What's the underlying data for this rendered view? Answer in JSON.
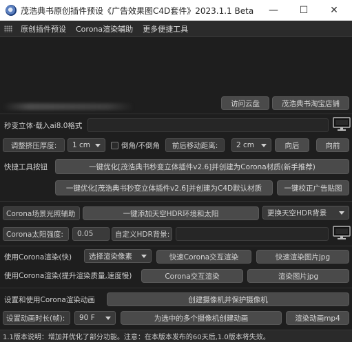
{
  "window": {
    "title": "茂浩典书原创插件预设《广告效果图C4D套件》2023.1.1 Beta",
    "minimize": "—",
    "maximize": "☐",
    "close": "✕"
  },
  "menu": [
    "原创插件预设",
    "Corona渲染辅助",
    "更多便捷工具"
  ],
  "links": {
    "cloud": "访问云盘",
    "shop": "茂浩典书淘宝店铺"
  },
  "import": {
    "label": "秒变立体·载入ai8.0格式",
    "value": ""
  },
  "extrude": {
    "label": "调整挤压厚度:",
    "value": "1 cm",
    "checkbox_label": "倒角/不倒角",
    "distance_label": "前后移动距离:",
    "distance_value": "2 cm",
    "back": "向后",
    "front": "向前"
  },
  "quick": {
    "label": "快捷工具按钮",
    "btn1": "一键优化[茂浩典书秒变立体插件v2.6]并创建为Corona材质(新手推荐)",
    "btn2": "一键优化[茂浩典书秒变立体插件v2.6]并创建为C4D默认材质",
    "btn3": "一键校正广告贴图"
  },
  "lighting": {
    "label": "Corona场景光照辅助",
    "add_hdr": "一键添加天空HDR环境和太阳",
    "replace_hdr": "更换天空HDR背景",
    "sun_label": "Corona太阳强度:",
    "sun_value": "0.05",
    "custom_hdr_label": "自定义HDR背景:",
    "custom_hdr_value": ""
  },
  "render": {
    "fast_label": "使用Corona渲染(快)",
    "pixel_select": "选择渲染像素",
    "fast_interactive": "快速Corona交互渲染",
    "fast_image": "快速渲染图片jpg",
    "hq_label": "使用Corona渲染(提升渲染质量,速度慢)",
    "hq_interactive": "Corona交互渲染",
    "hq_image": "渲染图片jpg"
  },
  "animation": {
    "setup_label": "设置和使用Corona渲染动画",
    "create_camera": "创建摄像机并保护摄像机",
    "duration_label": "设置动画时长(帧):",
    "duration_value": "90 F",
    "multi_cam": "为选中的多个摄像机创建动画",
    "render_mp4": "渲染动画mp4"
  },
  "status": "1.1版本说明：增加并优化了部分功能。注意：在本版本发布的60天后,1.0版本将失效。",
  "colors": {
    "background": "#1e1e1e",
    "button": "#4a4a4a",
    "titlebar": "#ffffff"
  }
}
